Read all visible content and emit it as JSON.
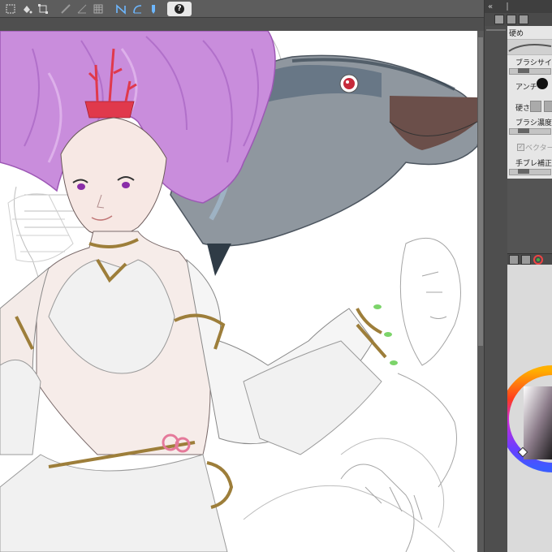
{
  "toolbar": {
    "tools": [
      "selection-icon",
      "bucket-icon",
      "transform-icon",
      "ruler-icon",
      "perspective-icon",
      "grid-icon",
      "symmetry-icon",
      "curve-ruler-icon",
      "pen-pressure-icon"
    ],
    "help_label": "?"
  },
  "panel": {
    "header_arrows": "«",
    "brush_name": "硬め",
    "labels": {
      "brush_size": "ブラシサイズ",
      "anti": "アンチ",
      "hardness": "硬さ",
      "brush_density": "ブラシ濃度",
      "vector": "ベクター",
      "stabilizer": "手ブレ補正"
    },
    "color_icon": "color-wheel-icon"
  },
  "colors": {
    "ui_dark": "#4a4a4a",
    "canvas_bg": "#ffffff",
    "hair": "#c77fd9",
    "gold": "#b89a55",
    "fish": "#8d969e",
    "accent_blue": "#1e5fa8"
  }
}
